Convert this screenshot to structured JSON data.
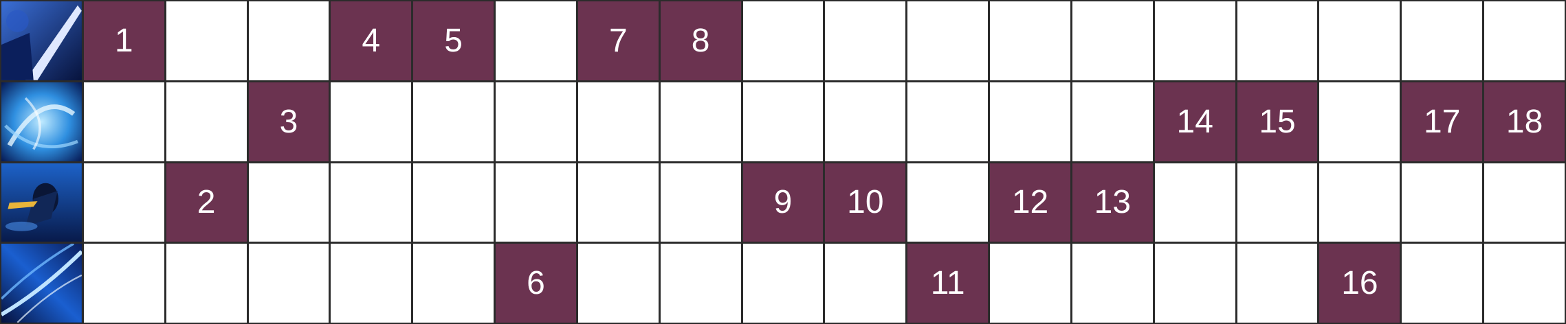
{
  "colors": {
    "filled": "#6b3350",
    "empty": "#ffffff",
    "grid_line": "#2b2b2b"
  },
  "rows": [
    {
      "icon": "ability-q-icon",
      "cells": [
        "1",
        "",
        "",
        "4",
        "5",
        "",
        "7",
        "8",
        "",
        "",
        "",
        "",
        "",
        "",
        "",
        "",
        "",
        ""
      ]
    },
    {
      "icon": "ability-w-icon",
      "cells": [
        "",
        "",
        "3",
        "",
        "",
        "",
        "",
        "",
        "",
        "",
        "",
        "",
        "",
        "14",
        "15",
        "",
        "17",
        "18"
      ]
    },
    {
      "icon": "ability-e-icon",
      "cells": [
        "",
        "2",
        "",
        "",
        "",
        "",
        "",
        "",
        "9",
        "10",
        "",
        "12",
        "13",
        "",
        "",
        "",
        "",
        ""
      ]
    },
    {
      "icon": "ability-r-icon",
      "cells": [
        "",
        "",
        "",
        "",
        "",
        "6",
        "",
        "",
        "",
        "",
        "11",
        "",
        "",
        "",
        "",
        "16",
        "",
        ""
      ]
    }
  ]
}
